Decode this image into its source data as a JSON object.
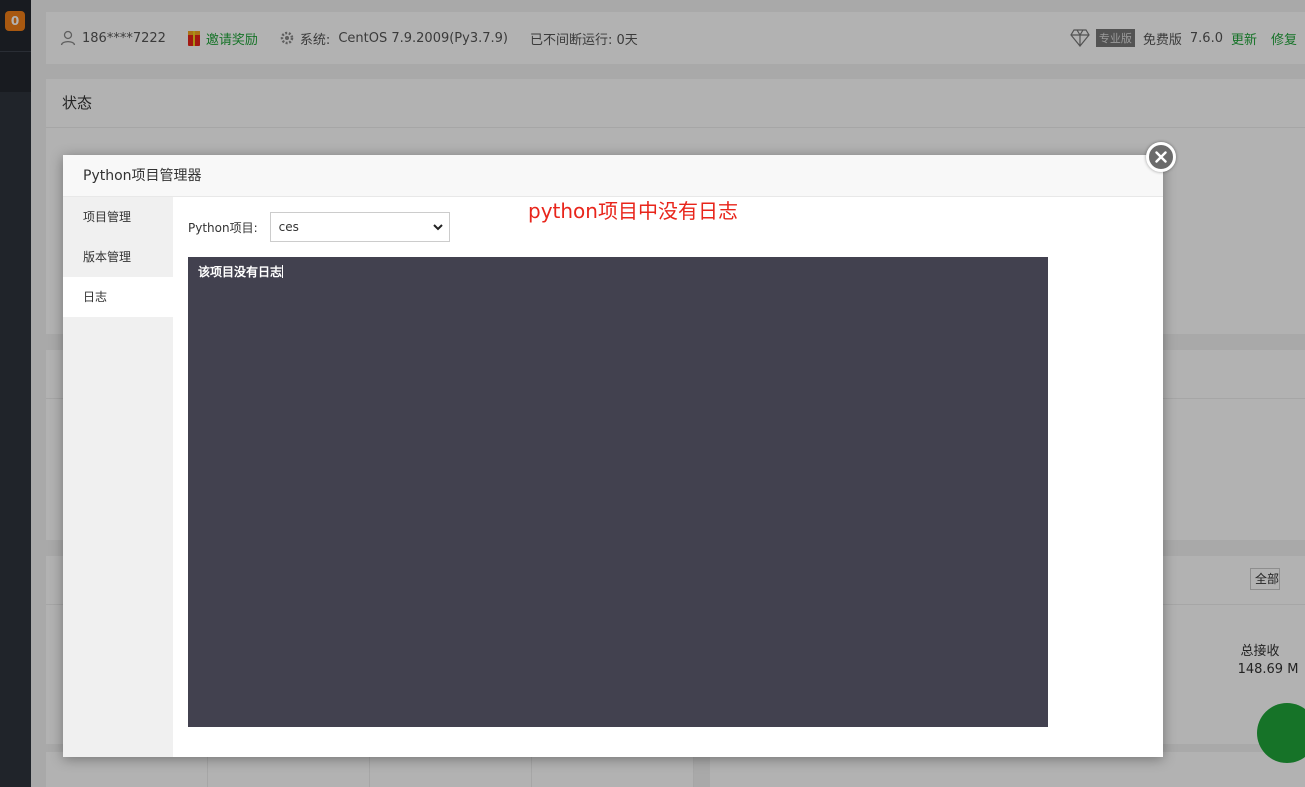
{
  "sidebar": {
    "badge": "0"
  },
  "topbar": {
    "user": "186****7222",
    "invite": "邀请奖励",
    "system_label": "系统:",
    "system_value": "CentOS 7.9.2009(Py3.7.9)",
    "uptime": "已不间断运行: 0天",
    "pro_tag": "专业版",
    "edition": "免费版",
    "version": "7.6.0",
    "update": "更新",
    "repair": "修复"
  },
  "status_panel": {
    "title": "状态"
  },
  "network": {
    "total_recv_label": "总接收",
    "total_recv_value": "148.69 M",
    "select_all": "全部"
  },
  "modal": {
    "title": "Python项目管理器",
    "tabs": [
      {
        "label": "项目管理"
      },
      {
        "label": "版本管理"
      },
      {
        "label": "日志"
      }
    ],
    "active_tab": "日志",
    "project_label": "Python项目:",
    "project_selected": "ces",
    "annotation": "python项目中没有日志",
    "log_text": "该项目没有日志"
  },
  "colors": {
    "accent_green": "#20a53a",
    "annotation_red": "#e8251b",
    "log_bg": "#42414f"
  }
}
